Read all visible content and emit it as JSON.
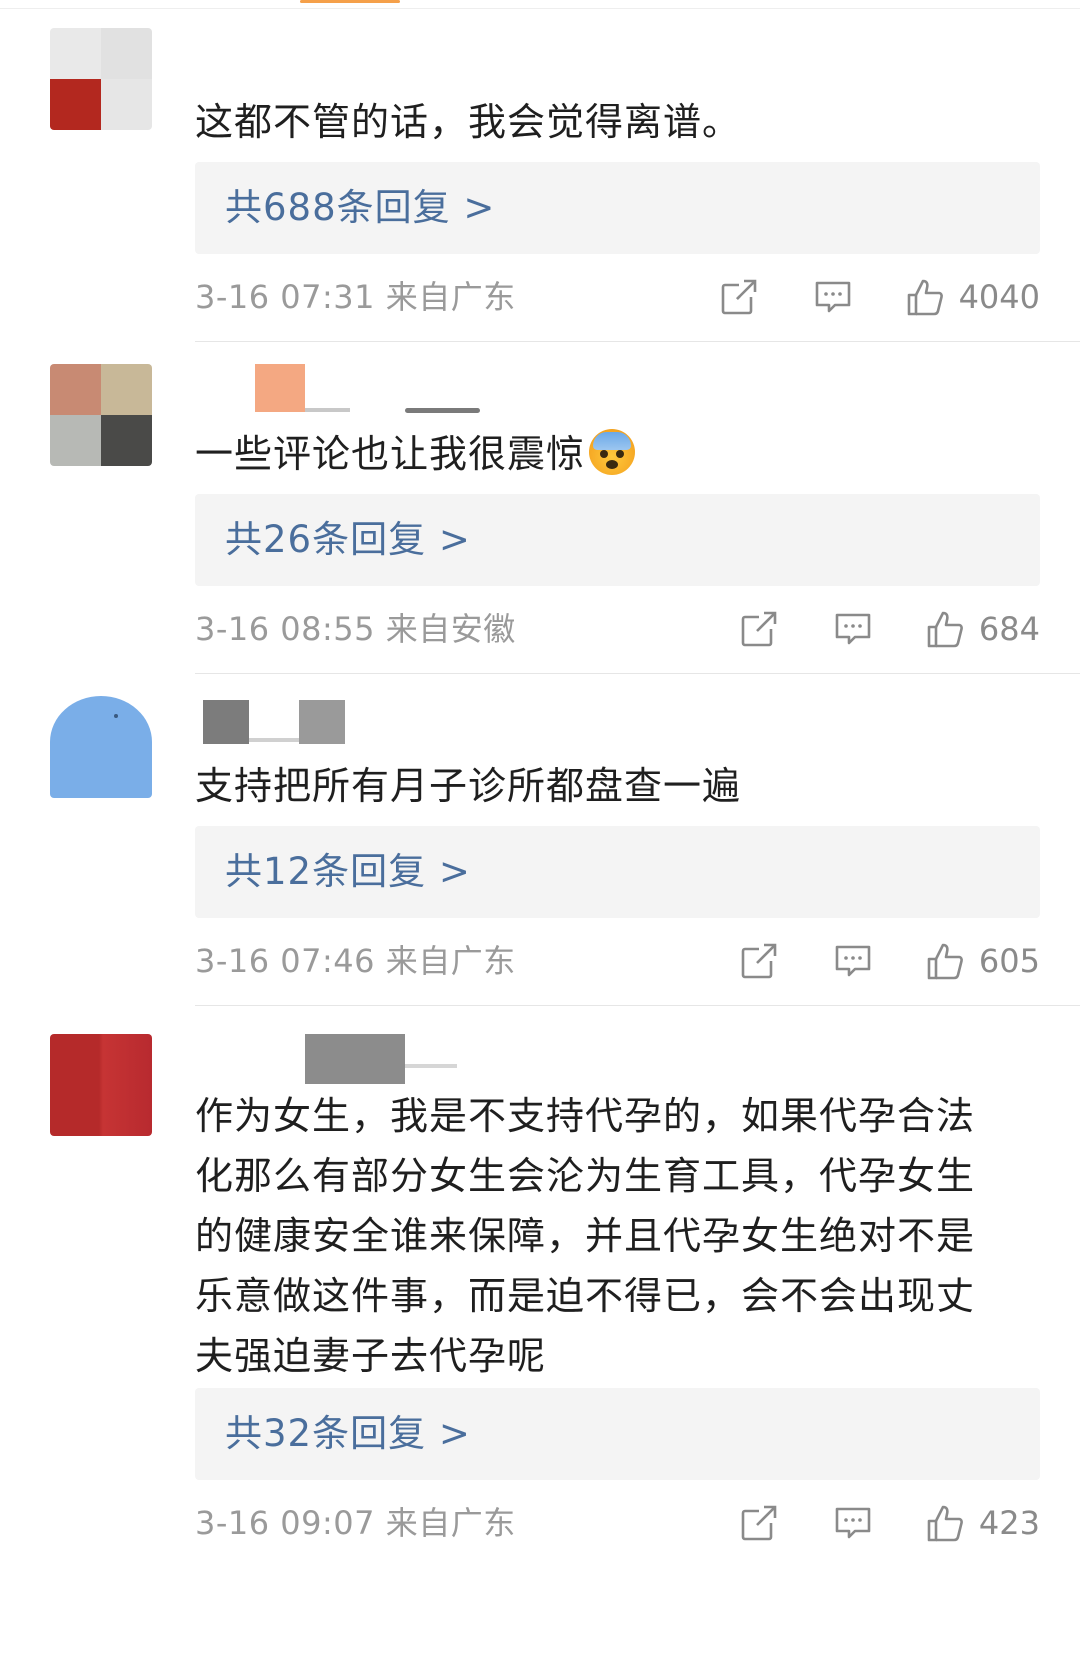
{
  "comments": [
    {
      "text": "这都不管的话，我会觉得离谱。",
      "replies_label": "共688条回复 >",
      "time": "3-16 07:31",
      "location": "来自广东",
      "likes": "4040"
    },
    {
      "text": "一些评论也让我很震惊",
      "emoji": "fearful-face-emoji",
      "replies_label": "共26条回复 >",
      "time": "3-16 08:55",
      "location": "来自安徽",
      "likes": "684"
    },
    {
      "text": "支持把所有月子诊所都盘查一遍",
      "replies_label": "共12条回复 >",
      "time": "3-16 07:46",
      "location": "来自广东",
      "likes": "605"
    },
    {
      "text_lines": [
        "作为女生，我是不支持代孕的，如果代孕合法",
        "化那么有部分女生会沦为生育工具，代孕女生",
        "的健康安全谁来保障，并且代孕女生绝对不是",
        "乐意做这件事，而是迫不得已，会不会出现丈",
        "夫强迫妻子去代孕呢"
      ],
      "replies_label": "共32条回复 >",
      "time": "3-16 09:07",
      "location": "来自广东",
      "likes": "423"
    }
  ],
  "icons": {
    "share": "share-icon",
    "comment": "comment-icon",
    "like": "thumbs-up-icon"
  },
  "colors": {
    "reply_link": "#4a6e9c",
    "meta_text": "#9a9a9a",
    "reply_box_bg": "#f4f4f4"
  }
}
